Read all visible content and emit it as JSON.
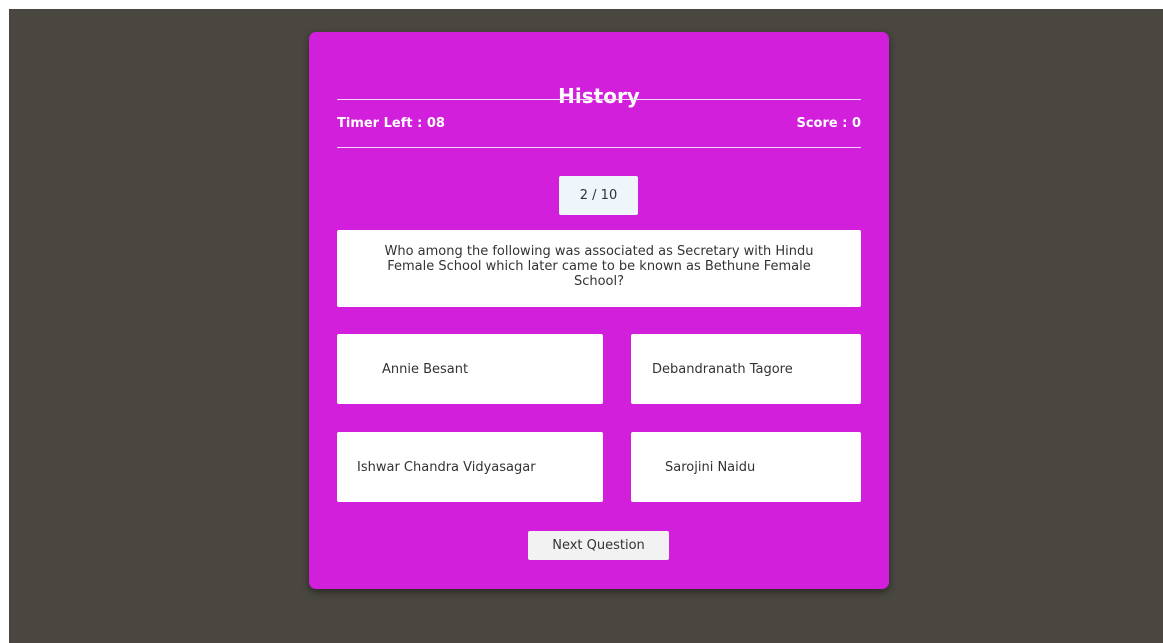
{
  "quiz": {
    "title": "History",
    "timer_text": "Timer Left : 08",
    "score_text": "Score : 0",
    "question_counter": "2 / 10",
    "question": "Who among the following was associated as Secretary with Hindu Female School which later came to be known as Bethune Female School?",
    "options": [
      "Annie Besant",
      "Debandranath Tagore",
      "Ishwar Chandra Vidyasagar",
      "Sarojini Naidu"
    ],
    "next_label": "Next Question"
  },
  "colors": {
    "background": "#4a4741",
    "card": "#d11fdb",
    "option_bg": "#ffffff",
    "counter_bg": "#eef5fb"
  }
}
